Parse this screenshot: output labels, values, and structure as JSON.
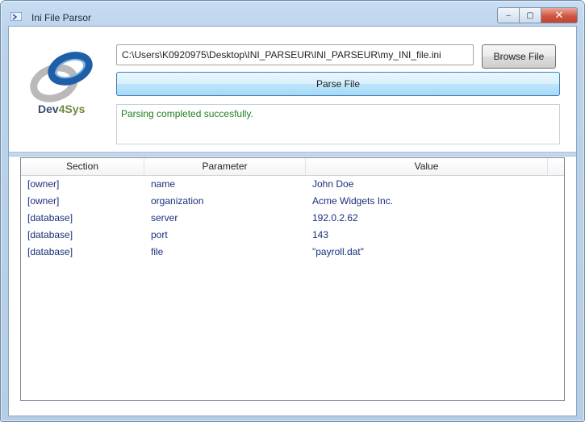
{
  "window": {
    "title": "Ini File Parsor",
    "controls": {
      "minimize": "–",
      "maximize": "▢",
      "close": "✕"
    }
  },
  "logo": {
    "text_main": "Dev",
    "text_accent": "4Sys"
  },
  "toolbar": {
    "file_path": "C:\\Users\\K0920975\\Desktop\\INI_PARSEUR\\INI_PARSEUR\\my_INI_file.ini",
    "browse_label": "Browse File",
    "parse_label": "Parse File"
  },
  "status": {
    "message": "Parsing completed succesfully."
  },
  "grid": {
    "columns": [
      "Section",
      "Parameter",
      "Value"
    ],
    "rows": [
      {
        "section": "[owner]",
        "parameter": "name",
        "value": "John Doe"
      },
      {
        "section": "[owner]",
        "parameter": "organization",
        "value": "Acme Widgets Inc."
      },
      {
        "section": "[database]",
        "parameter": "server",
        "value": "192.0.2.62"
      },
      {
        "section": "[database]",
        "parameter": "port",
        "value": "143"
      },
      {
        "section": "[database]",
        "parameter": "file",
        "value": "\"payroll.dat\""
      }
    ]
  },
  "colors": {
    "status_text": "#1f7f1f",
    "row_text": "#1a2f7a",
    "title_bar": "#c7ddf2"
  }
}
